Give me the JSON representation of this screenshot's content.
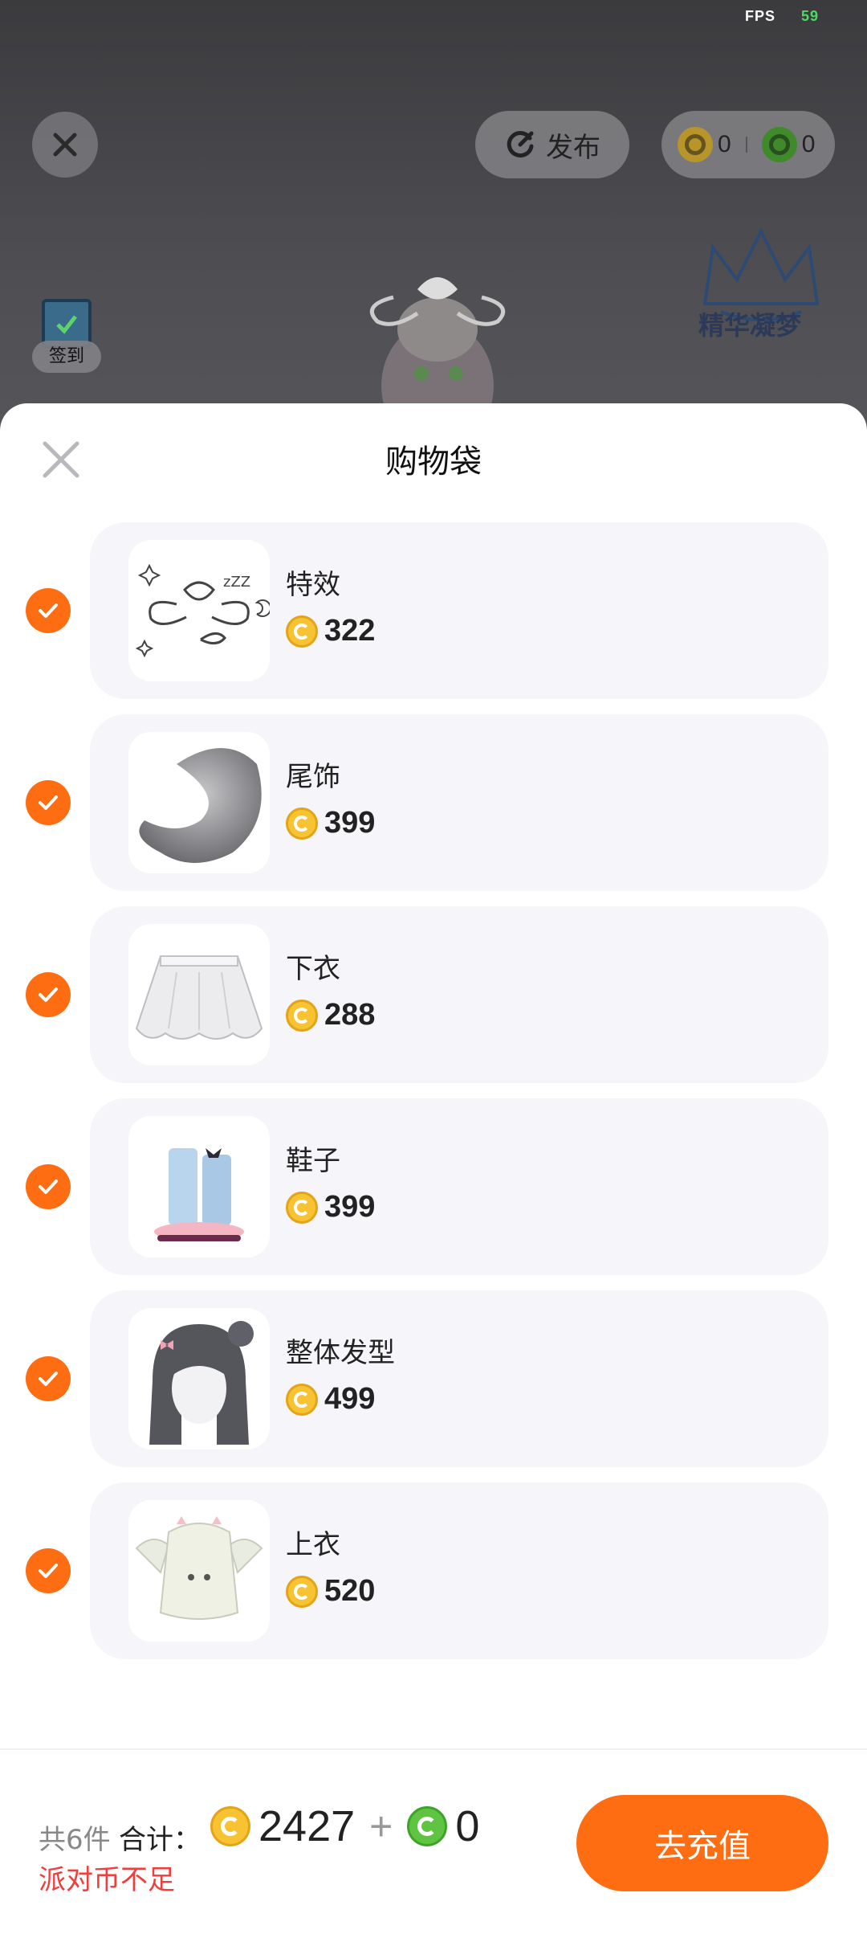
{
  "status": {
    "fps_label": "FPS",
    "fps_value": "59"
  },
  "topbar": {
    "publish_label": "发布",
    "gold_balance": "0",
    "green_balance": "0"
  },
  "scene": {
    "crown_caption": "精华凝梦",
    "signin_label": "签到"
  },
  "sheet": {
    "title": "购物袋"
  },
  "items": [
    {
      "name": "特效",
      "price": "322"
    },
    {
      "name": "尾饰",
      "price": "399"
    },
    {
      "name": "下衣",
      "price": "288"
    },
    {
      "name": "鞋子",
      "price": "399"
    },
    {
      "name": "整体发型",
      "price": "499"
    },
    {
      "name": "上衣",
      "price": "520"
    }
  ],
  "footer": {
    "count_text": "共6件",
    "total_label": "合计：",
    "gold_total": "2427",
    "plus": "+",
    "green_total": "0",
    "warning": "派对币不足",
    "recharge_label": "去充值"
  },
  "colors": {
    "accent": "#ff6d13",
    "warning": "#f23d3d",
    "gold_coin": "#f7c332",
    "green_coin": "#5fc441"
  }
}
